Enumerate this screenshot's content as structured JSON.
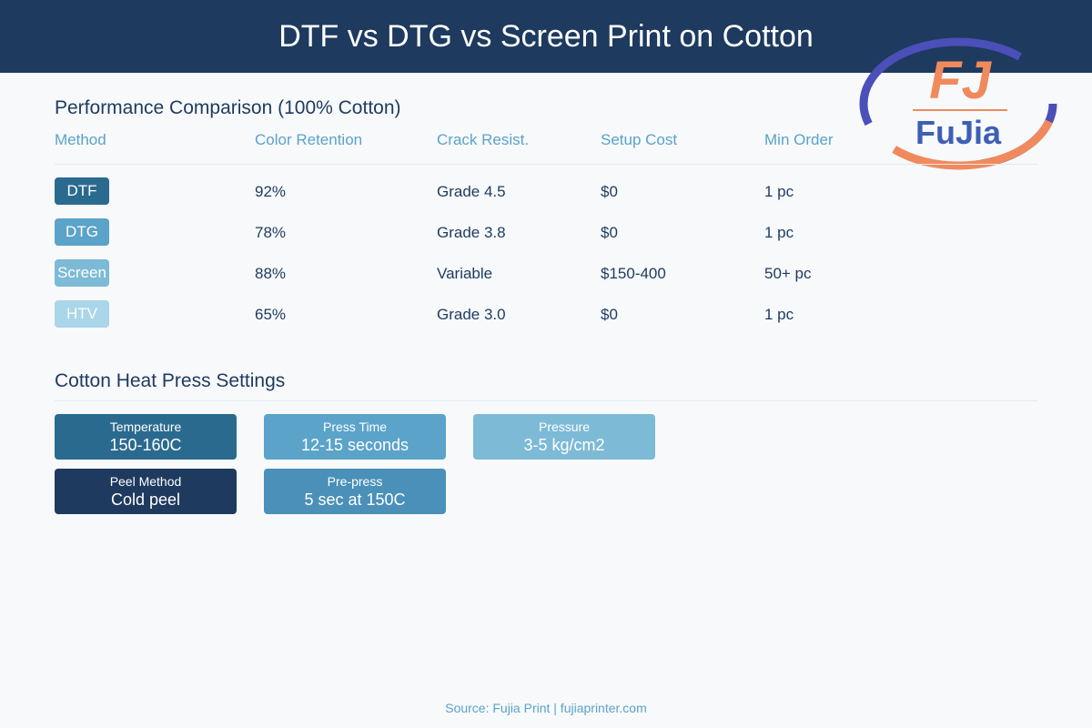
{
  "header": {
    "title": "DTF vs DTG vs Screen Print on Cotton"
  },
  "logo": {
    "text": "FuJia",
    "mark": "FJ",
    "colors": {
      "ring_purple": "#4b4fb8",
      "ring_orange": "#f08a5d",
      "text_blue": "#3f5fb5"
    }
  },
  "comparison": {
    "title": "Performance Comparison (100% Cotton)",
    "headers": [
      "Method",
      "Color Retention",
      "Crack Resist.",
      "Setup Cost",
      "Min Order"
    ],
    "rows": [
      {
        "method": "DTF",
        "color": "#2b6a8f",
        "retention": "92%",
        "crack": "Grade 4.5",
        "setup": "$0",
        "min": "1 pc"
      },
      {
        "method": "DTG",
        "color": "#5ba3c9",
        "retention": "78%",
        "crack": "Grade 3.8",
        "setup": "$0",
        "min": "1 pc"
      },
      {
        "method": "Screen",
        "color": "#7dbad6",
        "retention": "88%",
        "crack": "Variable",
        "setup": "$150-400",
        "min": "50+ pc"
      },
      {
        "method": "HTV",
        "color": "#a9d6e8",
        "retention": "65%",
        "crack": "Grade 3.0",
        "setup": "$0",
        "min": "1 pc"
      }
    ]
  },
  "settings": {
    "title": "Cotton Heat Press Settings",
    "cards": [
      {
        "label": "Temperature",
        "value": "150-160C",
        "color": "#2b6a8f"
      },
      {
        "label": "Press Time",
        "value": "12-15 seconds",
        "color": "#5ba3c9"
      },
      {
        "label": "Pressure",
        "value": "3-5 kg/cm2",
        "color": "#7dbad6"
      },
      {
        "label": "Peel Method",
        "value": "Cold peel",
        "color": "#1e3a5f"
      },
      {
        "label": "Pre-press",
        "value": "5 sec at 150C",
        "color": "#4a90b8"
      }
    ]
  },
  "footer": {
    "source": "Source: Fujia Print | fujiaprinter.com"
  }
}
